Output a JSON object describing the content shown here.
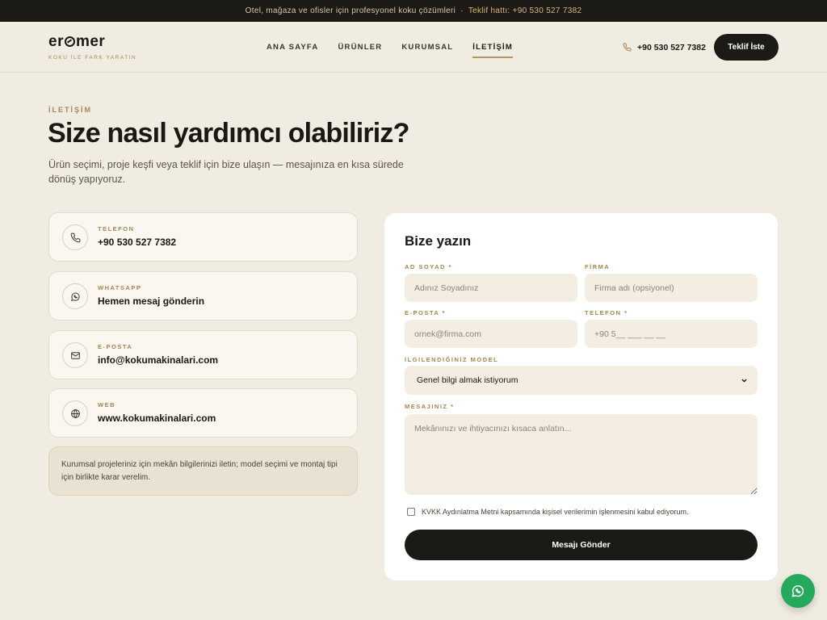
{
  "topbar": {
    "text": "Otel, mağaza ve ofisler için profesyonel koku çözümleri",
    "separator": "·",
    "hotline": "Teklif hattı: +90 530 527 7382"
  },
  "header": {
    "logo_wordmark_start": "er",
    "logo_wordmark_end": "mer",
    "logo_tagline": "KOKU İLE FARK YARATIN",
    "nav": [
      "ANA SAYFA",
      "ÜRÜNLER",
      "KURUMSAL",
      "İLETİŞİM"
    ],
    "active_nav": "İLETİŞİM",
    "phone": "+90 530 527 7382",
    "cta_label": "Teklif İste"
  },
  "hero": {
    "section_label": "İLETİŞİM",
    "title": "Size nasıl yardımcı olabiliriz?",
    "intro": "Ürün seçimi, proje keşfi veya teklif için bize ulaşın — mesajınıza en kısa sürede dönüş yapıyoruz."
  },
  "contacts": [
    {
      "label": "TELEFON",
      "value": "+90 530 527 7382",
      "icon": "phone-icon"
    },
    {
      "label": "WHATSAPP",
      "value": "Hemen mesaj gönderin",
      "icon": "whatsapp-icon"
    },
    {
      "label": "E-POSTA",
      "value": "info@kokumakinalari.com",
      "icon": "mail-icon"
    },
    {
      "label": "WEB",
      "value": "www.kokumakinalari.com",
      "icon": "globe-icon"
    }
  ],
  "note": "Kurumsal projeleriniz için mekân bilgilerinizi iletin; model seçimi ve montaj tipi için birlikte karar verelim.",
  "form": {
    "title": "Bize yazın",
    "name_label": "AD SOYAD *",
    "name_placeholder": "Adınız Soyadınız",
    "company_label": "FİRMA",
    "company_placeholder": "Firma adı (opsiyonel)",
    "email_label": "E-POSTA *",
    "email_placeholder": "ornek@firma.com",
    "phone_label": "TELEFON *",
    "phone_placeholder": "+90 5__ ___ __ __",
    "model_label": "İLGİLENDİĞİNİZ MODEL",
    "model_selected": "Genel bilgi almak istiyorum",
    "message_label": "MESAJINIZ *",
    "message_placeholder": "Mekânınızı ve ihtiyacınızı kısaca anlatın...",
    "consent": "KVKK Aydınlatma Metni kapsamında kişisel verilerimin işlenmesini kabul ediyorum.",
    "submit_label": "Mesajı Gönder"
  },
  "colors": {
    "background": "#f1ece1",
    "dark": "#1c1a17",
    "accent_gold": "#a4864f",
    "whatsapp_green": "#25a95c"
  }
}
